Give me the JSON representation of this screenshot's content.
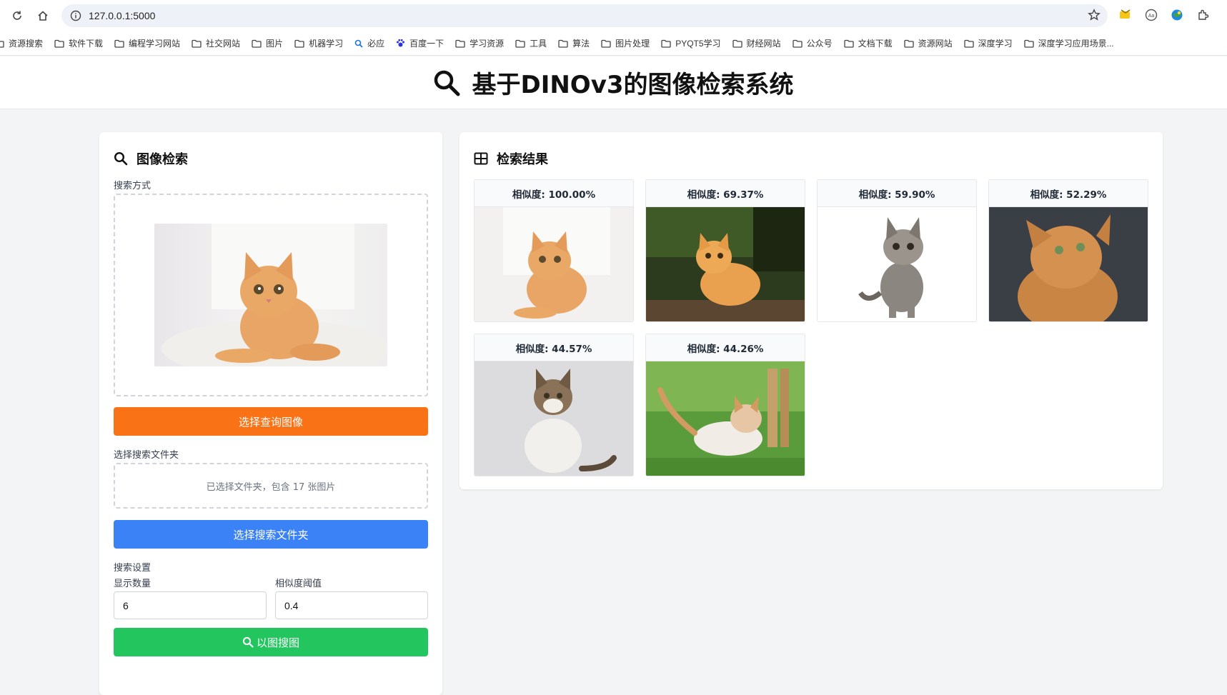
{
  "browser": {
    "url": "127.0.0.1:5000",
    "bookmarks": [
      {
        "label": "资源搜索",
        "icon": "folder-icon"
      },
      {
        "label": "软件下载",
        "icon": "folder-icon"
      },
      {
        "label": "编程学习网站",
        "icon": "folder-icon"
      },
      {
        "label": "社交网站",
        "icon": "folder-icon"
      },
      {
        "label": "图片",
        "icon": "folder-icon"
      },
      {
        "label": "机器学习",
        "icon": "folder-icon"
      },
      {
        "label": "必应",
        "icon": "search-icon"
      },
      {
        "label": "百度一下",
        "icon": "paw-icon"
      },
      {
        "label": "学习资源",
        "icon": "folder-icon"
      },
      {
        "label": "工具",
        "icon": "folder-icon"
      },
      {
        "label": "算法",
        "icon": "folder-icon"
      },
      {
        "label": "图片处理",
        "icon": "folder-icon"
      },
      {
        "label": "PYQT5学习",
        "icon": "folder-icon"
      },
      {
        "label": "财经网站",
        "icon": "folder-icon"
      },
      {
        "label": "公众号",
        "icon": "folder-icon"
      },
      {
        "label": "文档下载",
        "icon": "folder-icon"
      },
      {
        "label": "资源网站",
        "icon": "folder-icon"
      },
      {
        "label": "深度学习",
        "icon": "folder-icon"
      },
      {
        "label": "深度学习应用场景...",
        "icon": "folder-icon"
      }
    ]
  },
  "header": {
    "title": "基于DINOv3的图像检索系统"
  },
  "search_panel": {
    "title": "图像检索",
    "search_mode_label": "搜索方式",
    "select_image_button": "选择查询图像",
    "folder_label": "选择搜索文件夹",
    "folder_status": "已选择文件夹，包含 17 张图片",
    "select_folder_button": "选择搜索文件夹",
    "settings_label": "搜索设置",
    "count_label": "显示数量",
    "count_value": "6",
    "threshold_label": "相似度阈值",
    "threshold_value": "0.4",
    "search_button": "以图搜图"
  },
  "results_panel": {
    "title": "检索结果",
    "results": [
      {
        "similarity": "相似度: 100.00%"
      },
      {
        "similarity": "相似度: 69.37%"
      },
      {
        "similarity": "相似度: 59.90%"
      },
      {
        "similarity": "相似度: 52.29%"
      },
      {
        "similarity": "相似度: 44.57%"
      },
      {
        "similarity": "相似度: 44.26%"
      }
    ]
  },
  "colors": {
    "orange_button": "#f97316",
    "blue_button": "#3b82f6",
    "green_button": "#22c55e"
  }
}
